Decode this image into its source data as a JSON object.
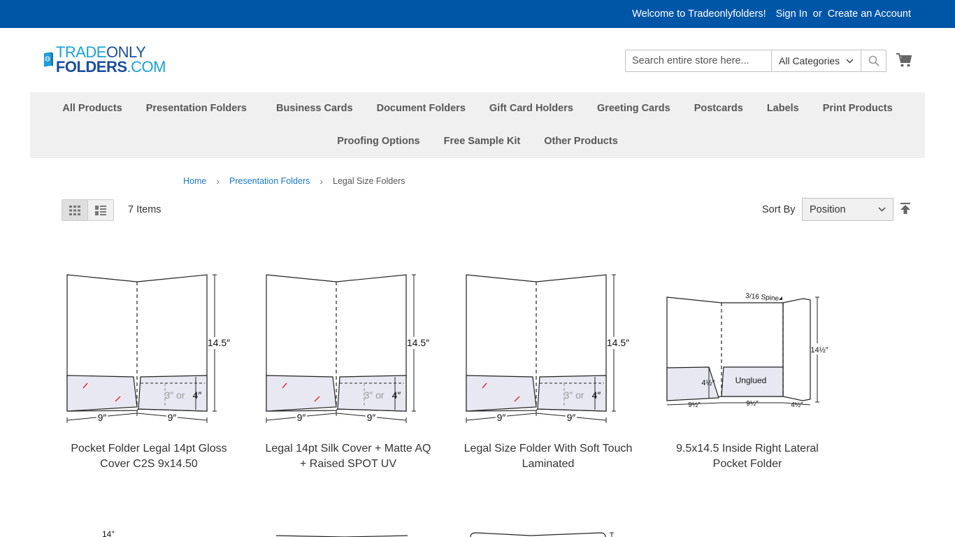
{
  "topbar": {
    "welcome": "Welcome to Tradeonlyfolders!",
    "sign_in": "Sign In",
    "or": "or",
    "create_account": "Create an Account"
  },
  "logo": {
    "line1a": "TRADE",
    "line1b": "ONLY",
    "line2a": "FOLDERS",
    "line2b": ".COM"
  },
  "search": {
    "placeholder": "Search entire store here...",
    "category": "All Categories"
  },
  "nav": {
    "row1": [
      "All Products",
      "Presentation Folders",
      "Business Cards",
      "Document Folders",
      "Gift Card Holders",
      "Greeting Cards",
      "Postcards",
      "Labels",
      "Print Products"
    ],
    "row2": [
      "Proofing Options",
      "Free Sample Kit",
      "Other Products"
    ]
  },
  "breadcrumb": {
    "home": "Home",
    "category": "Presentation Folders",
    "current": "Legal Size Folders"
  },
  "toolbar": {
    "items_count": "7 Items",
    "sort_label": "Sort By",
    "sort_value": "Position"
  },
  "products": [
    {
      "name": "Pocket Folder Legal 14pt Gloss Cover C2S 9x14.50",
      "height_label": "14.5″",
      "width_left": "9″",
      "width_right": "9″",
      "pocket_text_a": "3″ or",
      "pocket_text_b": "4″"
    },
    {
      "name": "Legal 14pt Silk Cover + Matte AQ + Raised SPOT UV",
      "height_label": "14.5″",
      "width_left": "9″",
      "width_right": "9″",
      "pocket_text_a": "3″ or",
      "pocket_text_b": "4″"
    },
    {
      "name": "Legal Size Folder With Soft Touch Laminated",
      "height_label": "14.5″",
      "width_left": "9″",
      "width_right": "9″",
      "pocket_text_a": "3″ or",
      "pocket_text_b": "4″"
    },
    {
      "name": "9.5x14.5 Inside Right Lateral Pocket Folder",
      "spine_label": "3/16 Spine",
      "height_label": "14½″",
      "pocket_label": "4½″",
      "unglued": "Unglued",
      "w1": "9½″",
      "w2": "9½″",
      "w3": "4½″"
    }
  ],
  "partial_labels": {
    "p5_fragment": "14″"
  },
  "colors": {
    "topbar": "#0056a6",
    "nav_bg": "#f0f0f0",
    "link": "#1979c3",
    "pocket_fill": "#e8e8f2"
  }
}
